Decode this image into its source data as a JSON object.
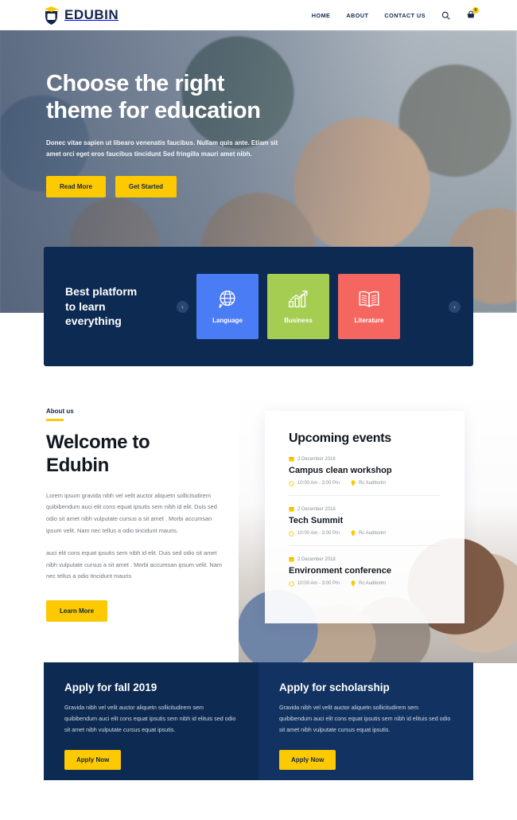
{
  "brand": {
    "name": "EDUBIN",
    "logo_icon": "graduation-cap-shield-icon"
  },
  "header": {
    "nav": [
      {
        "label": "HOME",
        "name": "nav-home"
      },
      {
        "label": "ABOUT",
        "name": "nav-about"
      },
      {
        "label": "CONTACT US",
        "name": "nav-contact-us"
      }
    ],
    "search_icon": "search-icon",
    "cart_icon": "cart-icon",
    "cart_badge": "0"
  },
  "hero": {
    "title_line1": "Choose the right",
    "title_line2": "theme for education",
    "subtitle": "Donec vitae sapien ut libearo venenatis faucibus. Nullam quis ante. Etiam sit amet orci eget eros faucibus tincidunt Sed fringilla mauri amet nibh.",
    "primary_button": "Read More",
    "secondary_button": "Get Started"
  },
  "platform": {
    "title_line1": "Best platform",
    "title_line2": "to learn",
    "title_line3": "everything",
    "prev_icon": "chevron-left-icon",
    "next_icon": "chevron-right-icon",
    "cards": [
      {
        "label": "Language",
        "icon": "globe-icon",
        "color": "#4a7cf5"
      },
      {
        "label": "Business",
        "icon": "bar-chart-arrow-icon",
        "color": "#a5cd51"
      },
      {
        "label": "Literature",
        "icon": "open-book-icon",
        "color": "#f4665f"
      }
    ]
  },
  "about": {
    "eyebrow": "About us",
    "title_line1": "Welcome to",
    "title_line2": "Edubin",
    "paragraph1": "Lorem ipsum gravida nibh vel velit auctor aliquetn sollicitudirem quibibendum auci elit cons equat ipsutis sem nibh id elit. Duis sed odio sit amet nibh vulputate cursus a sit amet . Morbi accumsan ipsum velit. Nam nec tellus a odio tincidunt mauris.",
    "paragraph2": "auci elit cons equat ipsutis sem nibh id elit. Duis sed odio sit amet nibh vulputate cursus a sit amet . Morbi accumsan ipsum velit. Nam nec tellus a odio tincidunt mauris",
    "button": "Learn More"
  },
  "events": {
    "title": "Upcoming events",
    "items": [
      {
        "date": "2 December 2018",
        "name": "Campus clean workshop",
        "time": "10:00 Am - 3:00 Pm",
        "location": "Rc Auditorim"
      },
      {
        "date": "2 December 2018",
        "name": "Tech Summit",
        "time": "10:00 Am - 3:00 Pm",
        "location": "Rc Auditorim"
      },
      {
        "date": "2 December 2018",
        "name": "Environment conference",
        "time": "10:00 Am - 3:00 Pm",
        "location": "Rc Auditorim"
      }
    ],
    "calendar_icon": "calendar-icon",
    "clock_icon": "clock-icon",
    "pin_icon": "map-pin-icon"
  },
  "apply": {
    "panels": [
      {
        "heading": "Apply for fall 2019",
        "text": "Gravida nibh vel velit auctor aliquetn sollicitudirem sem quibibendum auci elit cons equat ipsutis sem nibh id elituis sed odio sit amet nibh vulputate cursus equat ipsutis.",
        "button": "Apply Now"
      },
      {
        "heading": "Apply for scholarship",
        "text": "Gravida nibh vel velit auctor aliquetn sollicitudirem sem quibibendum auci elit cons equat ipsutis sem nibh id elituis sed odio sit amet nibh vulputate cursus equat ipsutis.",
        "button": "Apply Now"
      }
    ]
  },
  "colors": {
    "accent_yellow": "#fdc900",
    "navy": "#0c2a52",
    "navy_light": "#123362",
    "text_dark": "#111820",
    "text_muted": "#6f7580"
  }
}
